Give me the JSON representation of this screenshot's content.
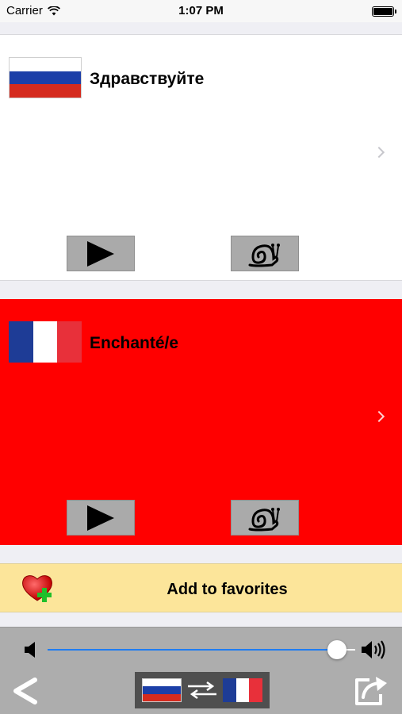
{
  "status_bar": {
    "carrier": "Carrier",
    "time": "1:07 PM"
  },
  "colors": {
    "source_card_bg": "#ffffff",
    "target_card_bg": "#ff0000",
    "button_bg": "#aaaaaa",
    "favorites_bg": "#fce59a",
    "toolbar_bg": "#adadad",
    "slider_fill": "#1e7cf2",
    "ru_white": "#ffffff",
    "ru_blue": "#1c3fa8",
    "ru_red": "#d52b1e",
    "fr_blue": "#1e3c96",
    "fr_white": "#ffffff",
    "fr_red": "#e8303a"
  },
  "source": {
    "flag_icon": "russia-flag-icon",
    "phrase": "Здравствуйте",
    "play_icon": "play-icon",
    "slow_icon": "snail-icon"
  },
  "target": {
    "flag_icon": "france-flag-icon",
    "phrase": "Enchanté/e",
    "play_icon": "play-icon",
    "slow_icon": "snail-icon"
  },
  "favorites": {
    "icon": "heart-add-icon",
    "label": "Add to favorites"
  },
  "toolbar": {
    "volume_level": 0.94,
    "back_icon": "back-chevron-icon",
    "swap_icon": "swap-languages-icon",
    "share_icon": "share-icon"
  }
}
